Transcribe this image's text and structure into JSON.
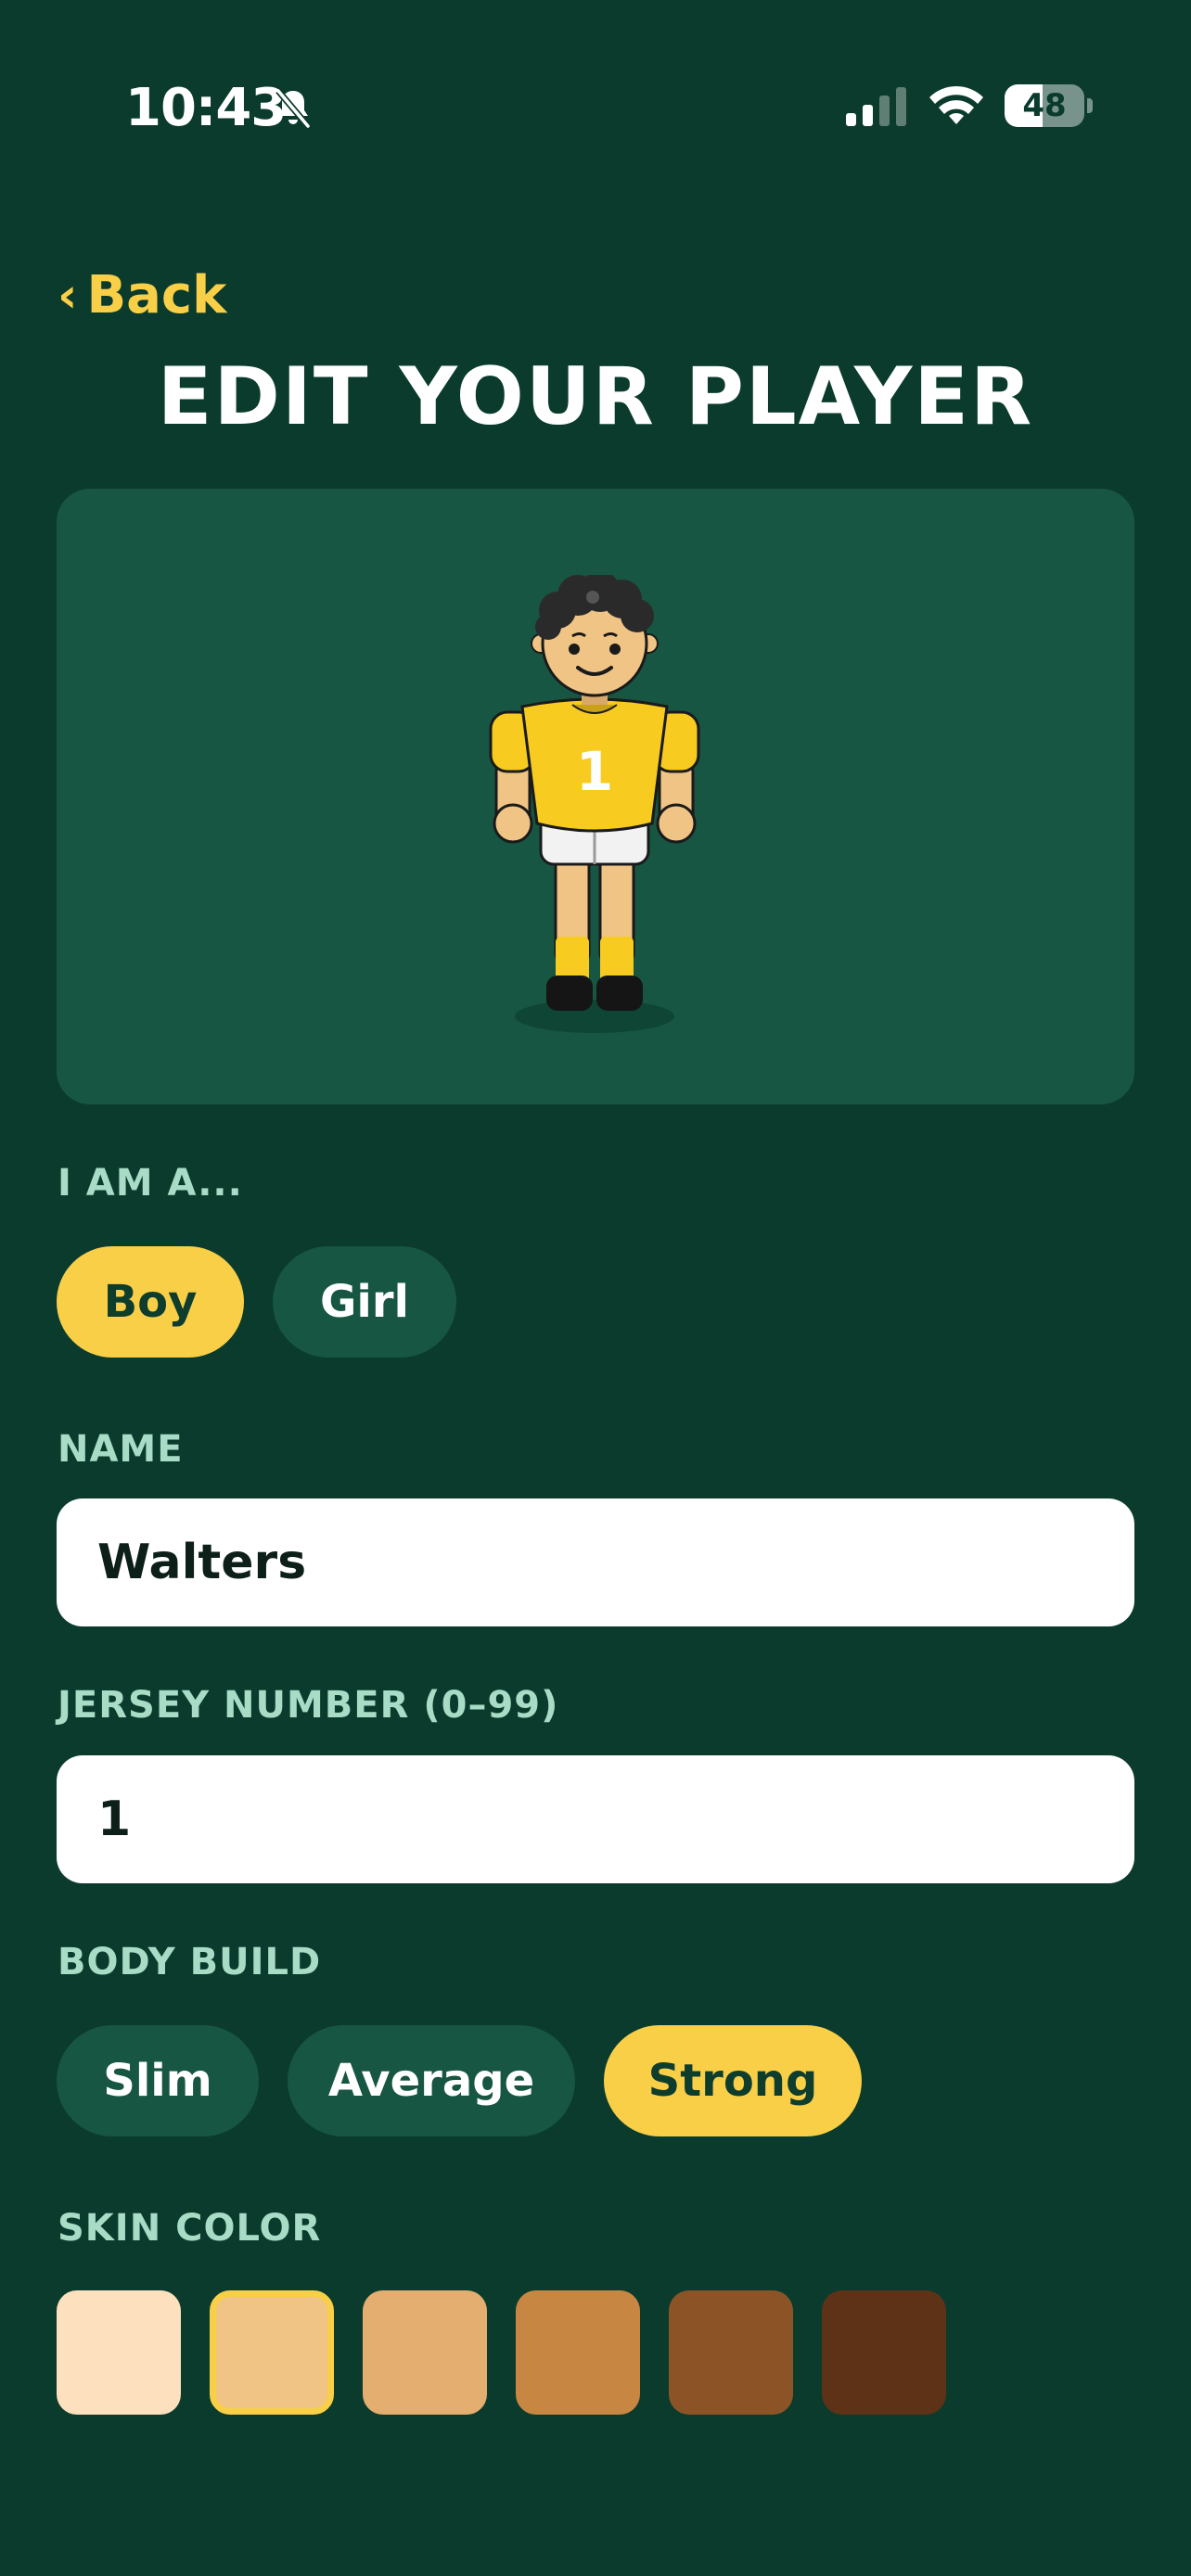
{
  "status_bar": {
    "time": "10:43",
    "battery_level": "48",
    "battery_fraction": 0.48,
    "icons": [
      "bell-slash-icon",
      "cellular-signal-icon",
      "wifi-icon",
      "battery-icon"
    ]
  },
  "header": {
    "back_chevron": "‹",
    "back_label": "Back",
    "title": "EDIT YOUR PLAYER"
  },
  "preview": {
    "jersey_number": "1",
    "jersey_color": "#f7cb1f",
    "skin_color": "#f0c485",
    "hair_color": "#2a2a2a",
    "shorts_color": "#f2f2f2",
    "socks_color": "#f7cb1f",
    "boots_color": "#151515"
  },
  "gender": {
    "label": "I AM A...",
    "options": [
      {
        "label": "Boy",
        "selected": true
      },
      {
        "label": "Girl",
        "selected": false
      }
    ]
  },
  "name": {
    "label": "NAME",
    "value": "Walters"
  },
  "jersey": {
    "label": "JERSEY NUMBER (0–99)",
    "value": "1"
  },
  "build": {
    "label": "BODY BUILD",
    "options": [
      {
        "label": "Slim",
        "selected": false
      },
      {
        "label": "Average",
        "selected": false
      },
      {
        "label": "Strong",
        "selected": true
      }
    ]
  },
  "skin": {
    "label": "SKIN COLOR",
    "swatches": [
      {
        "color": "#fde0bd",
        "selected": false
      },
      {
        "color": "#f0c485",
        "selected": true
      },
      {
        "color": "#e3ae6f",
        "selected": false
      },
      {
        "color": "#c78642",
        "selected": false
      },
      {
        "color": "#8c5426",
        "selected": false
      },
      {
        "color": "#5e3217",
        "selected": false
      }
    ]
  },
  "colors": {
    "background": "#0a3b2c",
    "card": "#175643",
    "accent": "#f9cf48",
    "label": "#a8dcc6"
  }
}
